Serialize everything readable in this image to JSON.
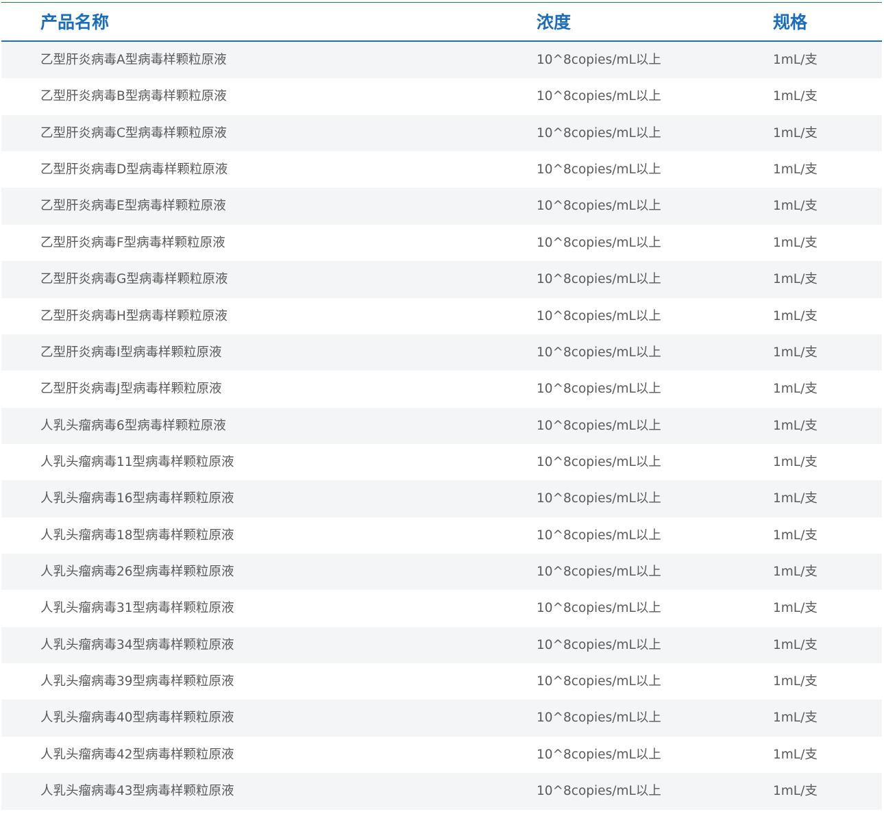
{
  "table": {
    "headers": {
      "name": "产品名称",
      "concentration": "浓度",
      "spec": "规格"
    },
    "rows": [
      {
        "name": "乙型肝炎病毒A型病毒样颗粒原液",
        "concentration": "10^8copies/mL以上",
        "spec": "1mL/支"
      },
      {
        "name": "乙型肝炎病毒B型病毒样颗粒原液",
        "concentration": "10^8copies/mL以上",
        "spec": "1mL/支"
      },
      {
        "name": "乙型肝炎病毒C型病毒样颗粒原液",
        "concentration": "10^8copies/mL以上",
        "spec": "1mL/支"
      },
      {
        "name": "乙型肝炎病毒D型病毒样颗粒原液",
        "concentration": "10^8copies/mL以上",
        "spec": "1mL/支"
      },
      {
        "name": "乙型肝炎病毒E型病毒样颗粒原液",
        "concentration": "10^8copies/mL以上",
        "spec": "1mL/支"
      },
      {
        "name": "乙型肝炎病毒F型病毒样颗粒原液",
        "concentration": "10^8copies/mL以上",
        "spec": "1mL/支"
      },
      {
        "name": "乙型肝炎病毒G型病毒样颗粒原液",
        "concentration": "10^8copies/mL以上",
        "spec": "1mL/支"
      },
      {
        "name": "乙型肝炎病毒H型病毒样颗粒原液",
        "concentration": "10^8copies/mL以上",
        "spec": "1mL/支"
      },
      {
        "name": "乙型肝炎病毒I型病毒样颗粒原液",
        "concentration": "10^8copies/mL以上",
        "spec": "1mL/支"
      },
      {
        "name": "乙型肝炎病毒J型病毒样颗粒原液",
        "concentration": "10^8copies/mL以上",
        "spec": "1mL/支"
      },
      {
        "name": "人乳头瘤病毒6型病毒样颗粒原液",
        "concentration": "10^8copies/mL以上",
        "spec": "1mL/支"
      },
      {
        "name": "人乳头瘤病毒11型病毒样颗粒原液",
        "concentration": "10^8copies/mL以上",
        "spec": "1mL/支"
      },
      {
        "name": "人乳头瘤病毒16型病毒样颗粒原液",
        "concentration": "10^8copies/mL以上",
        "spec": "1mL/支"
      },
      {
        "name": "人乳头瘤病毒18型病毒样颗粒原液",
        "concentration": "10^8copies/mL以上",
        "spec": "1mL/支"
      },
      {
        "name": "人乳头瘤病毒26型病毒样颗粒原液",
        "concentration": "10^8copies/mL以上",
        "spec": "1mL/支"
      },
      {
        "name": "人乳头瘤病毒31型病毒样颗粒原液",
        "concentration": "10^8copies/mL以上",
        "spec": "1mL/支"
      },
      {
        "name": "人乳头瘤病毒34型病毒样颗粒原液",
        "concentration": "10^8copies/mL以上",
        "spec": "1mL/支"
      },
      {
        "name": "人乳头瘤病毒39型病毒样颗粒原液",
        "concentration": "10^8copies/mL以上",
        "spec": "1mL/支"
      },
      {
        "name": "人乳头瘤病毒40型病毒样颗粒原液",
        "concentration": "10^8copies/mL以上",
        "spec": "1mL/支"
      },
      {
        "name": "人乳头瘤病毒42型病毒样颗粒原液",
        "concentration": "10^8copies/mL以上",
        "spec": "1mL/支"
      },
      {
        "name": "人乳头瘤病毒43型病毒样颗粒原液",
        "concentration": "10^8copies/mL以上",
        "spec": "1mL/支"
      }
    ]
  },
  "colors": {
    "accent": "#1a6dbd",
    "row_shade": "#f4f5f7",
    "text": "#5a5a5a"
  }
}
